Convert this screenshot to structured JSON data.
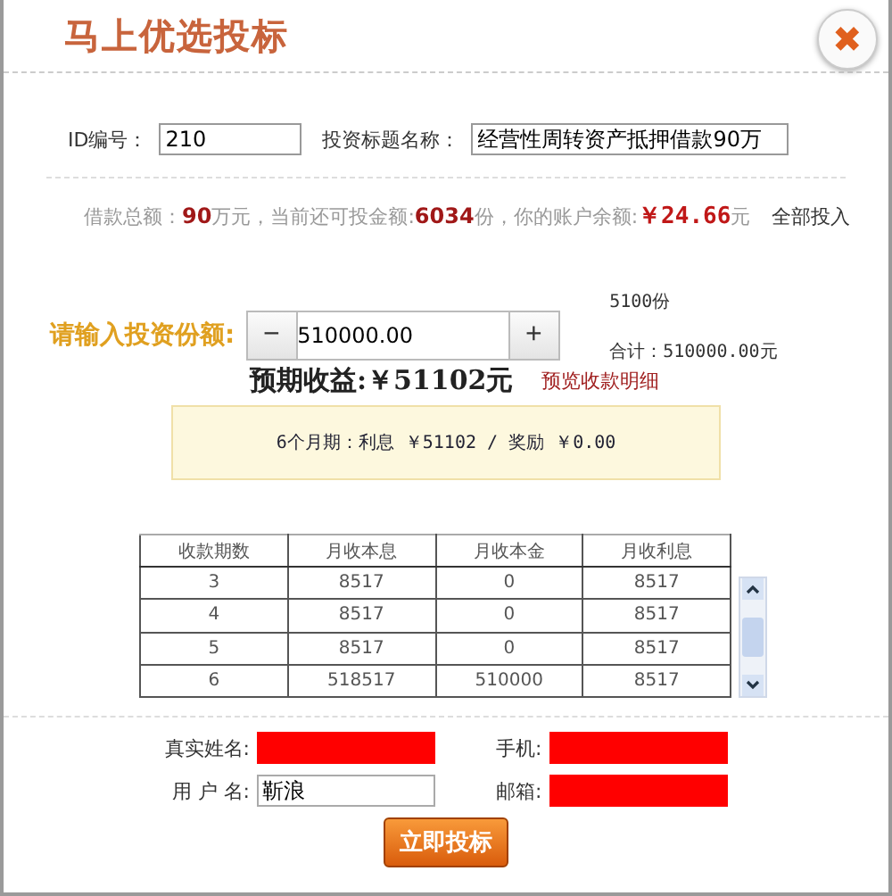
{
  "window": {
    "title": "马上优选投标",
    "close_icon": "✖"
  },
  "fields": [
    {
      "label": "ID编号：",
      "value": "210"
    },
    {
      "label": "投资标题名称：",
      "value": "经营性周转资产抵押借款90万"
    }
  ],
  "summary": {
    "text": "借款总额：**90**万元，当前还可投金额:**6034**份，你的账户余额:",
    "balance": "￥24.66",
    "unit": "元",
    "link": "全部投入"
  },
  "amount": {
    "label": "请输入投资份额:",
    "minus": "−",
    "value": "510000.00",
    "plus": "+",
    "shares": "5100份",
    "total": "合计：510000.00元"
  },
  "expected": {
    "text": "预期收益:￥51102元",
    "link": "预览收款明细"
  },
  "notice": "6个月期：利息 ￥51102 / 奖励 ￥0.00",
  "table": {
    "columns": [
      "收款期数",
      "月收本息",
      "月收本金",
      "月收利息"
    ],
    "rows": [
      [
        "3",
        "8517",
        "0",
        "8517"
      ],
      [
        "4",
        "8517",
        "0",
        "8517"
      ],
      [
        "5",
        "8517",
        "0",
        "8517"
      ],
      [
        "6",
        "518517",
        "510000",
        "8517"
      ]
    ]
  },
  "user": [
    {
      "label": "真实姓名:",
      "redacted": true
    },
    {
      "label": "手机:",
      "redacted": true
    },
    {
      "label": "用 户 名:",
      "value": "靳浪",
      "redacted": false
    },
    {
      "label": "邮箱:",
      "redacted": true
    }
  ],
  "submit": "立即投标"
}
